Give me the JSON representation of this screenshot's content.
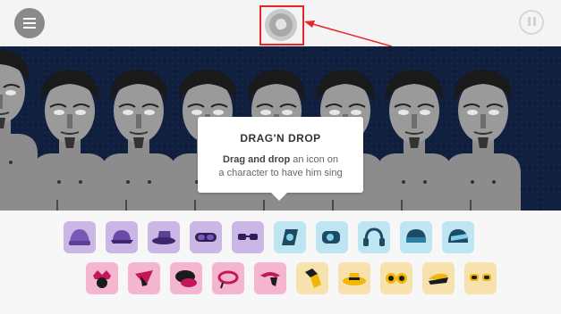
{
  "tooltip": {
    "title": "DRAG'N DROP",
    "body_bold": "Drag and drop",
    "body_rest_1": " an icon on",
    "body_rest_2": "a character to have him sing"
  },
  "colors": {
    "stage_bg": "#0f1f3d",
    "highlight": "#e8262a",
    "purple_tile": "#cbb7e6",
    "blue_tile": "#bde5f2",
    "pink_tile": "#f4b6cf",
    "yellow_tile": "#f7e1ac"
  },
  "icons": {
    "menu": "menu-icon",
    "center": "character-head-icon",
    "pause": "pause-icon"
  },
  "tray": {
    "row1": [
      {
        "group": "purple",
        "icon": "beanie-icon"
      },
      {
        "group": "purple",
        "icon": "cap-icon"
      },
      {
        "group": "purple",
        "icon": "hat-icon"
      },
      {
        "group": "purple",
        "icon": "goggles-icon"
      },
      {
        "group": "purple",
        "icon": "sunglasses-icon"
      },
      {
        "group": "blue",
        "icon": "eye-mask-icon"
      },
      {
        "group": "blue",
        "icon": "visor-icon"
      },
      {
        "group": "blue",
        "icon": "headphones-icon"
      },
      {
        "group": "blue",
        "icon": "helmet-icon"
      },
      {
        "group": "blue",
        "icon": "visor-helmet-icon"
      }
    ],
    "row2": [
      {
        "group": "pink",
        "icon": "crown-hat-icon"
      },
      {
        "group": "pink",
        "icon": "fan-hat-icon"
      },
      {
        "group": "pink",
        "icon": "beret-icon"
      },
      {
        "group": "pink",
        "icon": "ring-glasses-icon"
      },
      {
        "group": "pink",
        "icon": "swoop-hat-icon"
      },
      {
        "group": "yellow",
        "icon": "tie-icon"
      },
      {
        "group": "yellow",
        "icon": "straw-hat-icon"
      },
      {
        "group": "yellow",
        "icon": "round-glasses-icon"
      },
      {
        "group": "yellow",
        "icon": "wide-hat-icon"
      },
      {
        "group": "yellow",
        "icon": "shades-icon"
      }
    ]
  }
}
